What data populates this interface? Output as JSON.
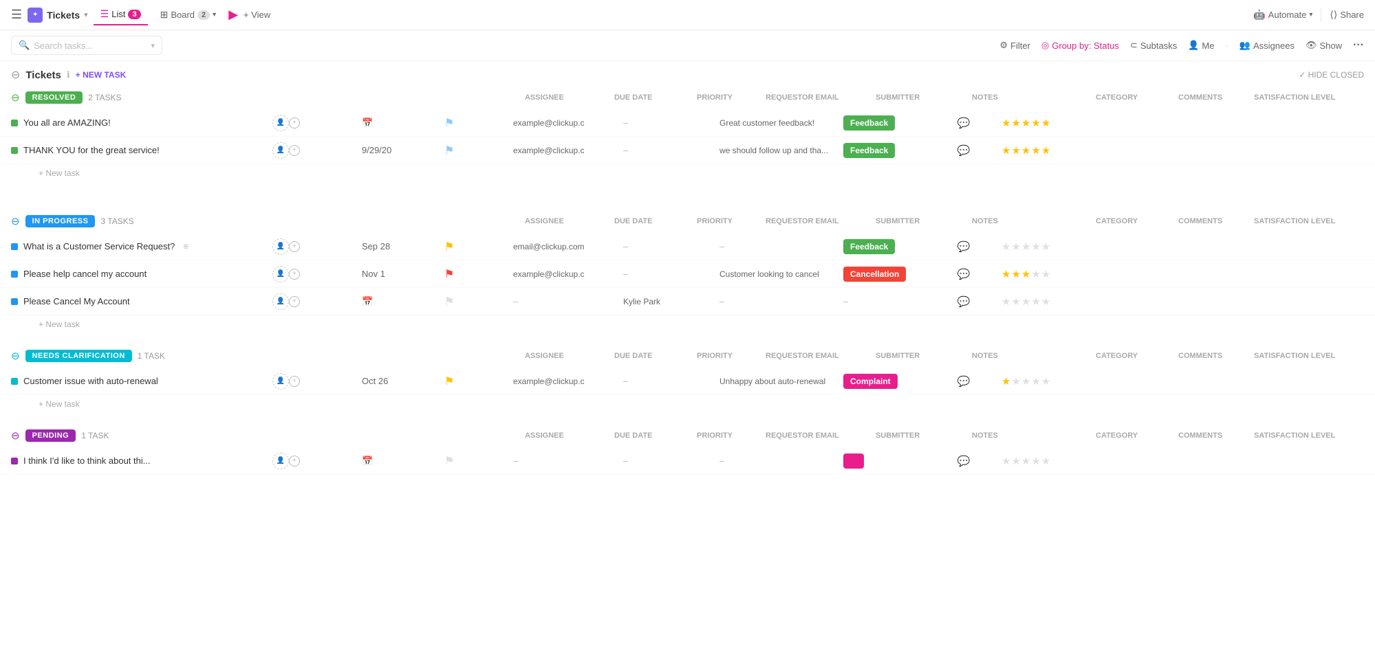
{
  "nav": {
    "menu_icon": "☰",
    "logo_icon": "✦",
    "logo_label": "Tickets",
    "logo_arrow": "▾",
    "tabs": [
      {
        "id": "list",
        "icon": "☰",
        "label": "List",
        "badge": "3",
        "active": true
      },
      {
        "id": "board",
        "icon": "⊞",
        "label": "Board",
        "badge": "2",
        "active": false
      }
    ],
    "play_icon": "▶",
    "add_view": "+ View",
    "automate": "Automate",
    "automate_arrow": "▾",
    "share": "Share",
    "share_icon": "⟨⟩"
  },
  "toolbar": {
    "search_placeholder": "Search tasks...",
    "search_arrow": "▾",
    "filter": "Filter",
    "group_by": "Group by: Status",
    "subtasks": "Subtasks",
    "me": "Me",
    "assignees": "Assignees",
    "show": "Show",
    "more": "..."
  },
  "page": {
    "collapse_icon": "⊖",
    "title": "Tickets",
    "info_icon": "ℹ",
    "new_task_btn": "+ NEW TASK",
    "hide_closed": "✓ HIDE CLOSED"
  },
  "sections": [
    {
      "id": "resolved",
      "toggle_icon": "⊖",
      "status_label": "RESOLVED",
      "status_class": "status-resolved",
      "dot_class": "dot-resolved",
      "task_count": "2 TASKS",
      "columns": [
        "ASSIGNEE",
        "DUE DATE",
        "PRIORITY",
        "REQUESTOR EMAIL",
        "SUBMITTER",
        "NOTES",
        "CATEGORY",
        "COMMENTS",
        "SATISFACTION LEVEL"
      ],
      "tasks": [
        {
          "name": "You all are AMAZING!",
          "assignee_placeholder": "👤",
          "due_date": "",
          "due_date_icon": "📅",
          "priority": "flag-blue",
          "priority_symbol": "⚑",
          "email": "example@clickup.c",
          "submitter": "–",
          "notes": "Great customer feedback!",
          "category": "Feedback",
          "category_class": "cat-feedback",
          "comments_icon": "💬",
          "stars": [
            true,
            true,
            true,
            true,
            true
          ]
        },
        {
          "name": "THANK YOU for the great service!",
          "assignee_placeholder": "👤",
          "due_date": "9/29/20",
          "priority": "flag-blue",
          "priority_symbol": "⚑",
          "email": "example@clickup.c",
          "submitter": "–",
          "notes": "we should follow up and tha...",
          "category": "Feedback",
          "category_class": "cat-feedback",
          "comments_icon": "💬",
          "stars": [
            true,
            true,
            true,
            true,
            true
          ]
        }
      ],
      "new_task_label": "+ New task"
    },
    {
      "id": "inprogress",
      "toggle_icon": "⊖",
      "status_label": "IN PROGRESS",
      "status_class": "status-inprogress",
      "dot_class": "dot-inprogress",
      "task_count": "3 TASKS",
      "columns": [
        "ASSIGNEE",
        "DUE DATE",
        "PRIORITY",
        "REQUESTOR EMAIL",
        "SUBMITTER",
        "NOTES",
        "CATEGORY",
        "COMMENTS",
        "SATISFACTION LEVEL"
      ],
      "tasks": [
        {
          "name": "What is a Customer Service Request?",
          "has_menu": true,
          "assignee_placeholder": "👤",
          "due_date": "Sep 28",
          "priority": "flag-yellow",
          "priority_symbol": "⚑",
          "email": "email@clickup.com",
          "submitter": "–",
          "notes": "–",
          "category": "Feedback",
          "category_class": "cat-feedback",
          "comments_icon": "💬",
          "stars": [
            false,
            false,
            false,
            false,
            false
          ]
        },
        {
          "name": "Please help cancel my account",
          "assignee_placeholder": "👤",
          "due_date": "Nov 1",
          "priority": "flag-red",
          "priority_symbol": "⚑",
          "email": "example@clickup.c",
          "submitter": "–",
          "notes": "Customer looking to cancel",
          "category": "Cancellation",
          "category_class": "cat-cancellation",
          "comments_icon": "💬",
          "stars": [
            true,
            true,
            true,
            false,
            false
          ]
        },
        {
          "name": "Please Cancel My Account",
          "assignee_placeholder": "👤",
          "due_date": "",
          "due_date_icon": "📅",
          "priority": "flag-grey",
          "priority_symbol": "⚑",
          "email": "–",
          "submitter": "Kylie Park",
          "notes": "–",
          "category": "–",
          "category_class": "",
          "comments_icon": "💬",
          "stars": [
            false,
            false,
            false,
            false,
            false
          ]
        }
      ],
      "new_task_label": "+ New task"
    },
    {
      "id": "clarification",
      "toggle_icon": "⊖",
      "status_label": "NEEDS CLARIFICATION",
      "status_class": "status-clarification",
      "dot_class": "dot-clarification",
      "task_count": "1 TASK",
      "columns": [
        "ASSIGNEE",
        "DUE DATE",
        "PRIORITY",
        "REQUESTOR EMAIL",
        "SUBMITTER",
        "NOTES",
        "CATEGORY",
        "COMMENTS",
        "SATISFACTION LEVEL"
      ],
      "tasks": [
        {
          "name": "Customer issue with auto-renewal",
          "assignee_placeholder": "👤",
          "due_date": "Oct 26",
          "priority": "flag-yellow",
          "priority_symbol": "⚑",
          "email": "example@clickup.c",
          "submitter": "–",
          "notes": "Unhappy about auto-renewal",
          "category": "Complaint",
          "category_class": "cat-complaint",
          "comments_icon": "💬",
          "stars": [
            true,
            false,
            false,
            false,
            false
          ]
        }
      ],
      "new_task_label": "+ New task"
    },
    {
      "id": "pending",
      "toggle_icon": "⊖",
      "status_label": "PENDING",
      "status_class": "status-pending",
      "dot_class": "dot-pending",
      "task_count": "1 TASK",
      "columns": [
        "ASSIGNEE",
        "DUE DATE",
        "PRIORITY",
        "REQUESTOR EMAIL",
        "SUBMITTER",
        "NOTES",
        "CATEGORY",
        "COMMENTS",
        "SATISFACTION LEVEL"
      ],
      "tasks": [
        {
          "name": "I think I'd like to think about thi...",
          "assignee_placeholder": "👤",
          "due_date": "",
          "priority": "flag-grey",
          "priority_symbol": "⚑",
          "email": "–",
          "submitter": "–",
          "notes": "–",
          "category": "",
          "category_class": "cat-pink",
          "comments_icon": "💬",
          "stars": [
            false,
            false,
            false,
            false,
            false
          ]
        }
      ],
      "new_task_label": "+ New task"
    }
  ],
  "colors": {
    "accent": "#e91e8c",
    "primary": "#7c4dff"
  }
}
